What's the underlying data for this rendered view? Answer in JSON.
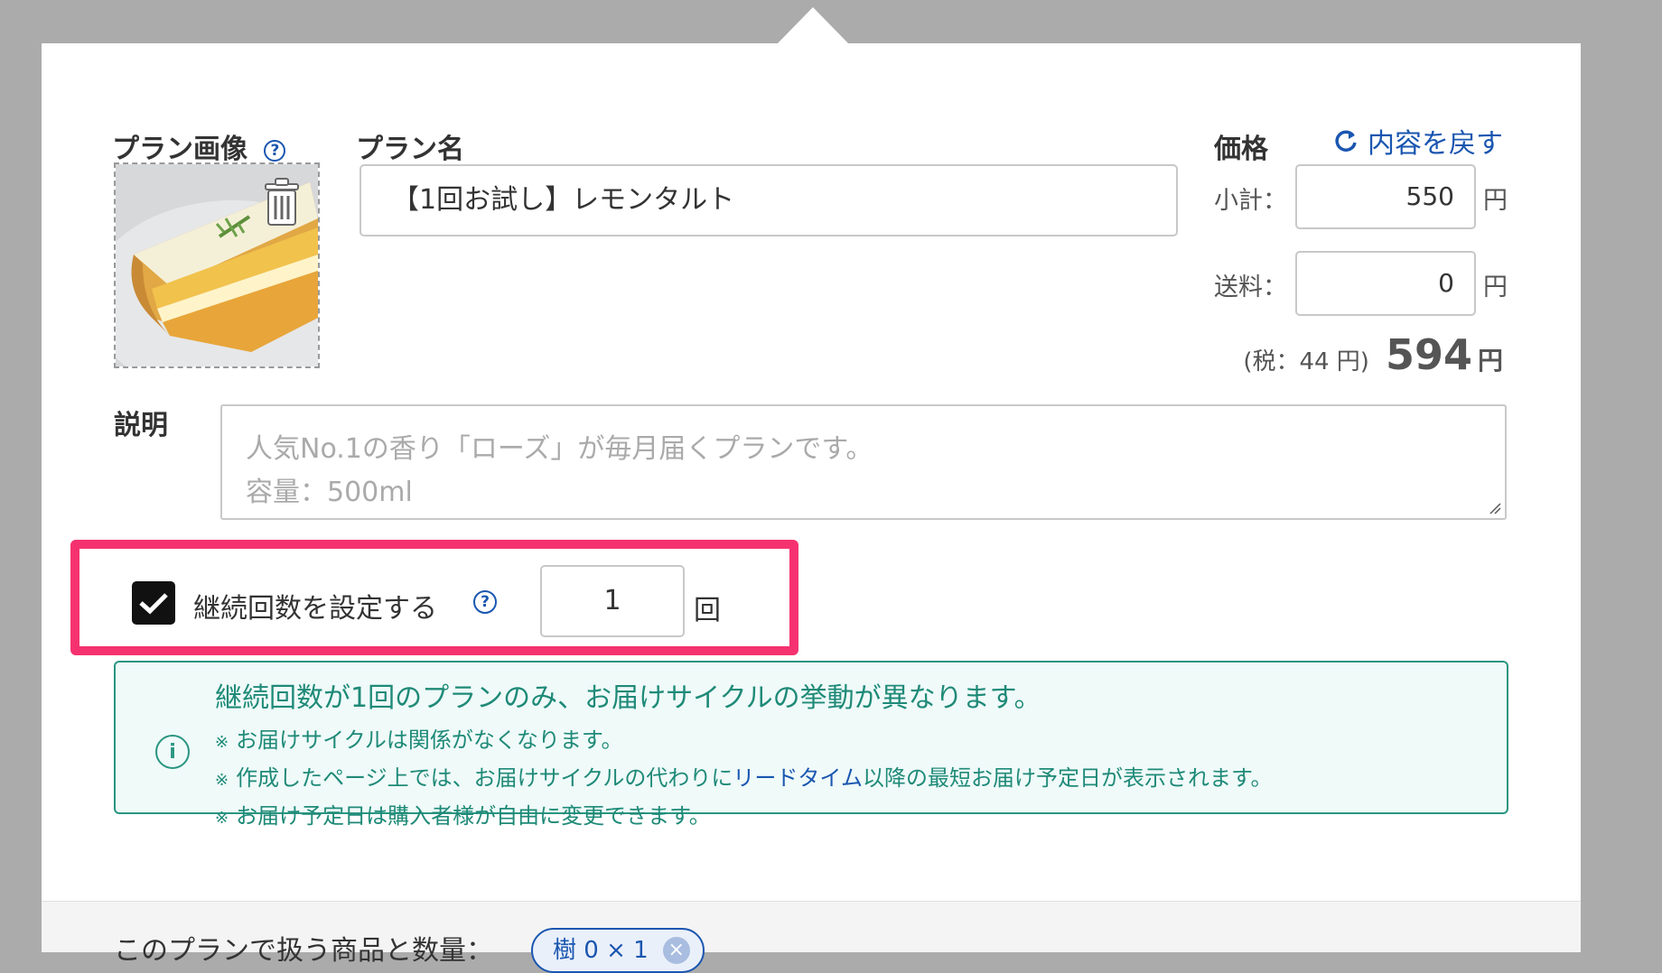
{
  "header": {
    "revert_label": "内容を戻す",
    "revert_icon": "refresh-icon"
  },
  "image_section": {
    "label": "プラン画像",
    "help": "?",
    "delete_icon": "trash-icon"
  },
  "plan_name": {
    "label": "プラン名",
    "value": "【1回お試し】レモンタルト"
  },
  "price": {
    "label": "価格",
    "subtotal_label": "小計：",
    "subtotal_value": "550",
    "shipping_label": "送料：",
    "shipping_value": "0",
    "currency": "円",
    "tax_note": "(税：44 円)",
    "total_value": "594",
    "total_currency": "円"
  },
  "description": {
    "label": "説明",
    "placeholder_line1": "人気No.1の香り「ローズ」が毎月届くプランです。",
    "placeholder_line2": "容量：500ml"
  },
  "continuation": {
    "checked": true,
    "label": "継続回数を設定する",
    "help": "?",
    "count_value": "1",
    "unit": "回"
  },
  "info": {
    "icon": "info-icon",
    "title": "継続回数が1回のプランのみ、お届けサイクルの挙動が異なります。",
    "mark": "※",
    "line1": "お届けサイクルは関係がなくなります。",
    "line2_before": "作成したページ上では、お届けサイクルの代わりに",
    "line2_link": "リードタイム",
    "line2_after": "以降の最短お届け予定日が表示されます。",
    "line3": "お届け予定日は購入者様が自由に変更できます。"
  },
  "products": {
    "label": "このプランで扱う商品と数量：",
    "chip_label": "樹 0 × 1",
    "chip_remove": "×"
  },
  "colors": {
    "accent": "#1a56b0",
    "highlight": "#f5326f",
    "info": "#1f8a78"
  }
}
